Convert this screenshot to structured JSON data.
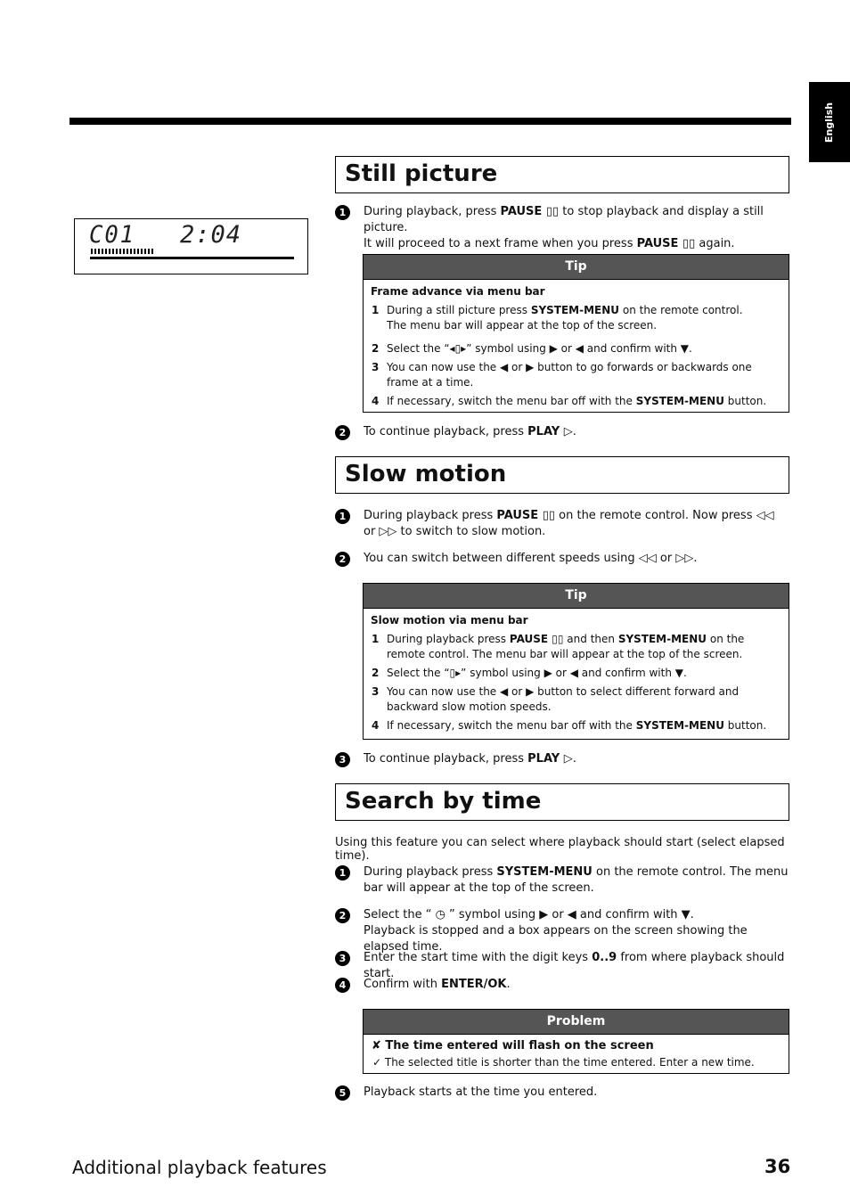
{
  "language_tab": "English",
  "lcd": {
    "chapter": "C01",
    "time": "2:04",
    "progress_ticks": 18
  },
  "still_picture": {
    "title": "Still picture",
    "step1": {
      "num": "1",
      "t1": "During playback, press ",
      "b1": "PAUSE ▯▯",
      "t2": " to stop playback and display a still picture.",
      "t3": "It will proceed to a next frame when you press ",
      "b2": "PAUSE ▯▯",
      "t4": " again."
    },
    "tip": {
      "header": "Tip",
      "subtitle": "Frame advance via menu bar",
      "items": [
        {
          "n": "1",
          "a": "During a still picture press ",
          "b": "SYSTEM-MENU",
          "c": " on the remote control.",
          "d": "The menu bar will appear at the top of the screen."
        },
        {
          "n": "2",
          "a": "Select the “◂▯▸” symbol using ▶ or ◀ and confirm with ▼."
        },
        {
          "n": "3",
          "a": "You can now use the ◀ or ▶ button to go forwards or backwards one frame at a time."
        },
        {
          "n": "4",
          "a": "If necessary, switch the menu bar off with the ",
          "b": "SYSTEM-MENU",
          "c": " button."
        }
      ]
    },
    "step2": {
      "num": "2",
      "t1": "To continue playback, press ",
      "b1": "PLAY ▷",
      "t2": "."
    }
  },
  "slow_motion": {
    "title": "Slow motion",
    "step1": {
      "num": "1",
      "t1": "During playback press ",
      "b1": "PAUSE ▯▯",
      "t2": " on the remote control. Now press ◁◁ or ▷▷ to switch to slow motion."
    },
    "step2": {
      "num": "2",
      "t1": "You can switch between different speeds using ◁◁ or ▷▷."
    },
    "tip": {
      "header": "Tip",
      "subtitle": "Slow motion via menu bar",
      "items": [
        {
          "n": "1",
          "a": "During playback press ",
          "b": "PAUSE ▯▯",
          "c": " and then ",
          "d": "SYSTEM-MENU",
          "e": " on the remote control. The menu bar will appear at the top of the screen."
        },
        {
          "n": "2",
          "a": "Select the “▯▸” symbol using ▶ or ◀ and confirm with ▼."
        },
        {
          "n": "3",
          "a": "You can now use the ◀ or ▶ button to select different forward and backward slow motion speeds."
        },
        {
          "n": "4",
          "a": "If necessary, switch the menu bar off with the ",
          "b": "SYSTEM-MENU",
          "c": " button."
        }
      ]
    },
    "step3": {
      "num": "3",
      "t1": "To continue playback, press ",
      "b1": "PLAY ▷",
      "t2": "."
    }
  },
  "search_by_time": {
    "title": "Search by time",
    "intro": "Using this feature you can select where playback should start (select elapsed time).",
    "step1": {
      "num": "1",
      "t1": "During playback press ",
      "b1": "SYSTEM-MENU",
      "t2": " on the remote control. The menu bar will appear at the top of the screen."
    },
    "step2": {
      "num": "2",
      "t1": "Select the “ ◷ ” symbol using ▶ or ◀ and confirm with ▼.",
      "t2": "Playback is stopped and a box appears on the screen showing the elapsed time."
    },
    "step3": {
      "num": "3",
      "t1": "Enter the start time with the digit keys ",
      "b1": "0..9",
      "t2": " from where playback should start."
    },
    "step4": {
      "num": "4",
      "t1": "Confirm with ",
      "b1": "ENTER/OK",
      "t2": "."
    },
    "problem": {
      "header": "Problem",
      "issue": "✘  The time entered will flash on the screen",
      "solution": "✓ The selected title is shorter than the time entered. Enter a new time."
    },
    "step5": {
      "num": "5",
      "t1": "Playback starts at the time you entered."
    }
  },
  "footer": {
    "section": "Additional playback features",
    "page": "36"
  }
}
